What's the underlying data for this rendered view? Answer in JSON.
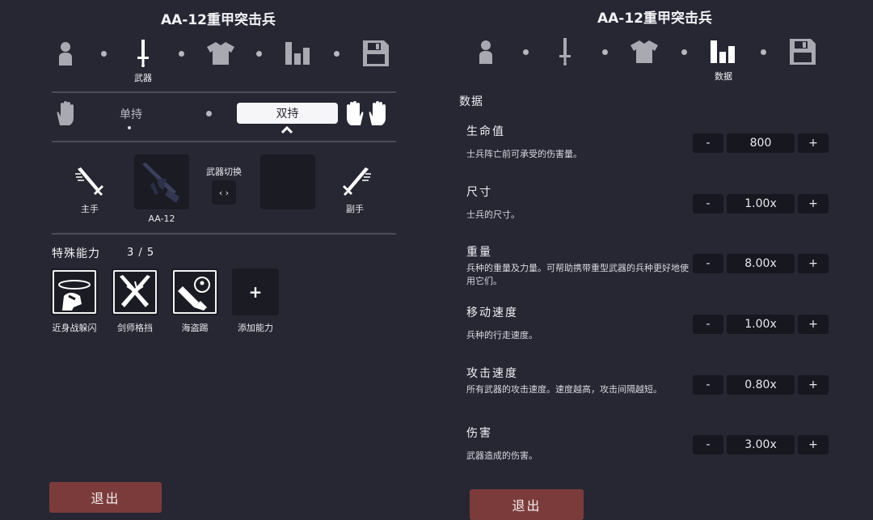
{
  "left": {
    "title": "AA-12重甲突击兵",
    "nav_active_label": "武器",
    "grip": {
      "single": "单持",
      "dual": "双持"
    },
    "main_hand": "主手",
    "off_hand": "副手",
    "weapon_name": "AA-12",
    "swap_label": "武器切换",
    "swap_icon": "‹ ›",
    "abilities_title": "特殊能力",
    "abilities_count": "3 / 5",
    "abilities": [
      {
        "label": "近身战躲闪",
        "icon": "dodge-icon"
      },
      {
        "label": "剑师格挡",
        "icon": "crossed-swords-icon"
      },
      {
        "label": "海盗踢",
        "icon": "pirate-kick-icon"
      }
    ],
    "add_ability": {
      "label": "添加能力",
      "symbol": "+"
    },
    "exit": "退出"
  },
  "right": {
    "title": "AA-12重甲突击兵",
    "nav_active_label": "数据",
    "section": "数据",
    "stats": [
      {
        "name": "生命值",
        "desc": "士兵阵亡前可承受的伤害量。",
        "value": "800"
      },
      {
        "name": "尺寸",
        "desc": "士兵的尺寸。",
        "value": "1.00x"
      },
      {
        "name": "重量",
        "desc": "兵种的重量及力量。可帮助携带重型武器的兵种更好地使用它们。",
        "value": "8.00x"
      },
      {
        "name": "移动速度",
        "desc": "兵种的行走速度。",
        "value": "1.00x"
      },
      {
        "name": "攻击速度",
        "desc": "所有武器的攻击速度。速度越高，攻击间隔越短。",
        "value": "0.80x"
      },
      {
        "name": "伤害",
        "desc": "武器造成的伤害。",
        "value": "3.00x"
      }
    ],
    "minus": "-",
    "plus": "+",
    "exit": "退出"
  },
  "colors": {
    "background": "#272733",
    "slot": "#1b1b23",
    "exit": "#7c3b3b",
    "active_icon": "#ffffff",
    "inactive_icon": "#a9a9b2"
  }
}
